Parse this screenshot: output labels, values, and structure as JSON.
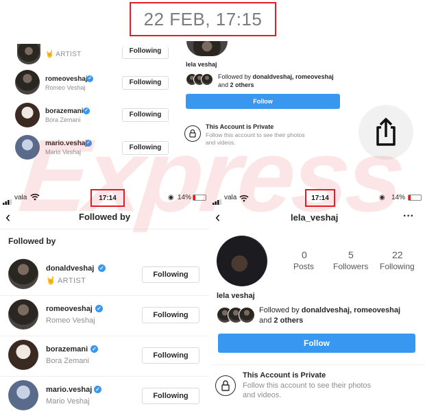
{
  "banner": {
    "date": "22 FEB, 17:15"
  },
  "watermark": "Express",
  "top_left_list": [
    {
      "sub": "🤘 ARTIST",
      "button": "Following"
    },
    {
      "username": "romeoveshaj",
      "name": "Romeo Veshaj",
      "button": "Following"
    },
    {
      "username": "borazemani",
      "name": "Bora Zemani",
      "button": "Following"
    },
    {
      "username": "mario.veshaj",
      "name": "Mario Veshaj",
      "button": "Following"
    }
  ],
  "top_right": {
    "name": "lela veshaj",
    "followed_by_prefix": "Followed by ",
    "followed_by_users": "donaldveshaj, romeoveshaj",
    "followed_by_and": "and ",
    "followed_by_others": "2 others",
    "follow_button": "Follow",
    "private_title": "This Account is Private",
    "private_text_1": "Follow this account to see their photos",
    "private_text_2": "and videos."
  },
  "left_screen": {
    "carrier": "vala",
    "time": "17:14",
    "battery": "14%",
    "title": "Followed by",
    "section": "Followed by",
    "rows": [
      {
        "username": "donaldveshaj",
        "sub": "🤘 ARTIST",
        "button": "Following"
      },
      {
        "username": "romeoveshaj",
        "sub": "Romeo Veshaj",
        "button": "Following"
      },
      {
        "username": "borazemani",
        "sub": "Bora Zemani",
        "button": "Following"
      },
      {
        "username": "mario.veshaj",
        "sub": "Mario Veshaj",
        "button": "Following"
      }
    ]
  },
  "right_screen": {
    "carrier": "vala",
    "time": "17:14",
    "battery": "14%",
    "title": "lela_veshaj",
    "more": "···",
    "stats": [
      {
        "count": "0",
        "label": "Posts"
      },
      {
        "count": "5",
        "label": "Followers"
      },
      {
        "count": "22",
        "label": "Following"
      }
    ],
    "name": "lela veshaj",
    "followed_by_prefix": "Followed by ",
    "followed_by_users": "donaldveshaj, romeoveshaj",
    "followed_by_and": "and ",
    "followed_by_others": "2 others",
    "follow_button": "Follow",
    "private_title": "This Account is Private",
    "private_text_1": "Follow this account to see their photos",
    "private_text_2": "and videos."
  },
  "colors": {
    "accent": "#3897f0",
    "highlight": "#e31b23",
    "battery_low": "#e31b23"
  }
}
